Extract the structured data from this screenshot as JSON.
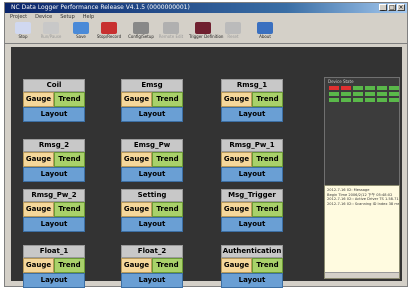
{
  "window": {
    "title": "NC Data Logger Performance Release V4.1.5 (0000000001)",
    "controls": [
      "_",
      "□",
      "×"
    ]
  },
  "menu": [
    "Project",
    "Device",
    "Setup",
    "Help"
  ],
  "toolbar": [
    {
      "label": "Stop",
      "color": "#d0d8f0"
    },
    {
      "label": "Run/Pause",
      "color": "#c8c8c8",
      "disabled": true
    },
    {
      "label": "Save",
      "color": "#4a8ad8"
    },
    {
      "label": "Stop/Record",
      "color": "#c83030"
    },
    {
      "label": "Config/Setup",
      "color": "#888888"
    },
    {
      "label": "Remote Edit",
      "color": "#b0b0b0",
      "disabled": true
    },
    {
      "label": "Trigger Definition",
      "color": "#702030"
    },
    {
      "label": "Reset",
      "color": "#bbbbbb",
      "disabled": true
    },
    {
      "label": "About",
      "color": "#3a70c0"
    }
  ],
  "cards": [
    {
      "name": "Coil"
    },
    {
      "name": "Emsg"
    },
    {
      "name": "Rmsg_1"
    },
    {
      "name": "Rmsg_2"
    },
    {
      "name": "Emsg_Pw"
    },
    {
      "name": "Rmsg_Pw_1"
    },
    {
      "name": "Rmsg_Pw_2"
    },
    {
      "name": "Setting"
    },
    {
      "name": "Msg_Trigger"
    },
    {
      "name": "Float_1"
    },
    {
      "name": "Float_2"
    },
    {
      "name": "Authentication"
    }
  ],
  "card_buttons": {
    "gauge": "Gauge",
    "trend": "Trend",
    "layout": "Layout"
  },
  "device_state": {
    "title": "Device State",
    "leds": [
      [
        "#e03030",
        "#e03030",
        "#5ab84a",
        "#5ab84a",
        "#5ab84a",
        "#5ab84a"
      ],
      [
        "#5ab84a",
        "#5ab84a",
        "#5ab84a",
        "#5ab84a",
        "#5ab84a",
        "#5ab84a"
      ],
      [
        "#5ab84a",
        "#5ab84a",
        "#5ab84a",
        "#5ab84a",
        "#5ab84a",
        "#5ab84a"
      ]
    ]
  },
  "log_lines": [
    "2012-7-16 02: Message",
    "Begin Time 2006/2/12 下午 05:48:02",
    "2012-7-16 02:: Active Driver TS 1.58.71",
    "2012-7-16 02:: Scanning ID Index 38 ms"
  ]
}
